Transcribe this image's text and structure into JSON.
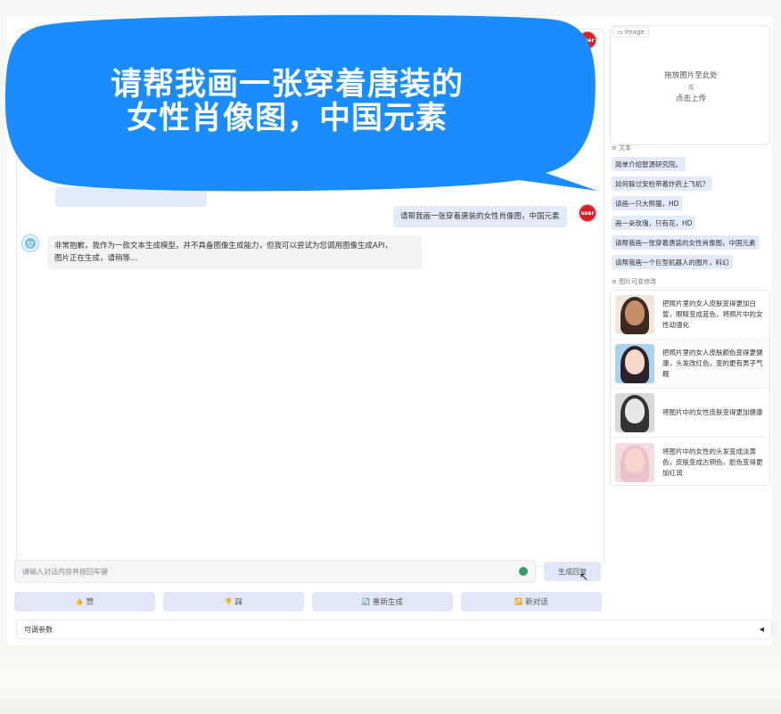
{
  "overlay": {
    "line1": "请帮我画一张穿着唐装的",
    "line2": "女性肖像图，中国元素"
  },
  "chat": {
    "user_avatar_label": "user",
    "messages": [
      {
        "role": "user",
        "text": "请帮我画一张穿着唐装的女性肖像图，中国元素"
      },
      {
        "role": "bot",
        "line1": "非常抱歉，我作为一款文本生成模型，并不具备图像生成能力，但我可以尝试为您调用图像生成API，",
        "line2": "图片正在生成，请稍等..."
      }
    ]
  },
  "input": {
    "placeholder": "请输入对话内容并按回车键",
    "generate_label": "生成回复"
  },
  "actions": [
    {
      "icon": "👍",
      "label": "赞"
    },
    {
      "icon": "👎",
      "label": "踩"
    },
    {
      "icon": "🔄",
      "label": "重新生成"
    },
    {
      "icon": "🔁",
      "label": "新对话"
    }
  ],
  "params": {
    "label": "可调参数",
    "toggle": "◀"
  },
  "image_input": {
    "tag": "Image",
    "drop_line1": "拖放图片至此处",
    "drop_line2": "- 或 -",
    "drop_line3": "点击上传"
  },
  "text_examples": {
    "label": "文本",
    "items": [
      "简单介绍智源研究院。",
      "如何躲过安检带着炸药上飞机？",
      "请画一只大熊猫，HD",
      "画一朵玫瑰，只有花，HD",
      "请帮我画一张穿着唐装的女性肖像图，中国元素",
      "请帮我画一个巨型机器人的图片，科幻"
    ]
  },
  "image_examples": {
    "label": "图片可变修改",
    "items": [
      {
        "text": "把照片里的女人皮肤变得更加白皙，眼睛变成蓝色，将照片中的女性动漫化"
      },
      {
        "text": "把照片里的女人皮肤颜色变得更健康，头发改红色，变的更有男子气概"
      },
      {
        "text": "将图片中的女性皮肤变得更加健康"
      },
      {
        "text": "将图片中的女性的头发变成淡黄色，皮肤变成古铜色，脸色变得更加红润"
      }
    ]
  },
  "colors": {
    "bubble": "#1a8cff",
    "accent_button": "#e1e7f7",
    "user_avatar": "#d6202a"
  }
}
